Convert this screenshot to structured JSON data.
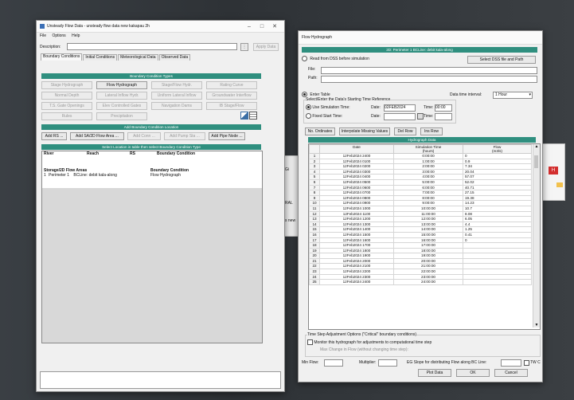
{
  "unsteady": {
    "title": "Unsteady Flow Data - unsteady flow data new kakapau 2h",
    "menu": [
      "File",
      "Options",
      "Help"
    ],
    "description_label": "Description:",
    "apply_label": "Apply Data",
    "tabs": [
      "Boundary Conditions",
      "Initial Conditions",
      "Meteorological Data",
      "Observed Data"
    ],
    "bc_types_header": "Boundary Condition Types",
    "bc_buttons": [
      {
        "label": "Stage Hydrograph",
        "enabled": false
      },
      {
        "label": "Flow Hydrograph",
        "enabled": true
      },
      {
        "label": "Stage/Flow Hydr.",
        "enabled": false
      },
      {
        "label": "Rating Curve",
        "enabled": false
      },
      {
        "label": "Normal Depth",
        "enabled": false
      },
      {
        "label": "Lateral Inflow Hydr.",
        "enabled": false
      },
      {
        "label": "Uniform Lateral Inflow",
        "enabled": false
      },
      {
        "label": "Groundwater Interflow",
        "enabled": false
      },
      {
        "label": "T.S. Gate Openings",
        "enabled": false
      },
      {
        "label": "Elev Controlled Gates",
        "enabled": false
      },
      {
        "label": "Navigation Dams",
        "enabled": false
      },
      {
        "label": "IB Stage/Flow",
        "enabled": false
      },
      {
        "label": "Rules",
        "enabled": false
      },
      {
        "label": "Precipitation",
        "enabled": false
      }
    ],
    "add_loc_header": "Add Boundary Condition Location",
    "add_buttons": [
      {
        "label": "Add RS ...",
        "enabled": true
      },
      {
        "label": "Add SA/2D Flow Area ...",
        "enabled": true
      },
      {
        "label": "Add Conn ...",
        "enabled": false
      },
      {
        "label": "Add Pump Sta ...",
        "enabled": false
      },
      {
        "label": "Add Pipe Node ...",
        "enabled": true
      }
    ],
    "select_header": "Select Location in table then select Boundary Condition Type",
    "loc_cols": [
      "River",
      "Reach",
      "RS",
      "Boundary Condition"
    ],
    "storage_header": [
      "Storage/2D Flow Areas",
      "Boundary Condition"
    ],
    "storage_rows": [
      {
        "num": "1",
        "area": "Perimeter 1",
        "line": "BCLine: debit kala-along",
        "bc": "Flow Hydrograph"
      }
    ]
  },
  "flow": {
    "title": "Flow Hydrograph",
    "location_header": "2D: Perimeter 1 BCLine: debit kala-along",
    "read_dss_label": "Read from DSS before simulation",
    "select_dss_label": "Select DSS file and Path",
    "file_label": "File:",
    "path_label": "Path:",
    "enter_table_label": "Enter Table",
    "interval_label": "Data time interval:",
    "interval_value": "1 Hour",
    "start_ref_label": "Select/Enter the Data's Starting Time Reference",
    "use_sim_label": "Use Simulation Time:",
    "date_label": "Date:",
    "sim_date": "02FEB2024",
    "time_label": "Time:",
    "sim_time": "00:00",
    "fixed_label": "Fixed Start Time:",
    "fixed_date_label": "Date:",
    "fixed_time_label": "Time:",
    "table_buttons": [
      "No. Ordinates",
      "Interpolate Missing Values",
      "Del Row",
      "Ins Row"
    ],
    "table_header": "Hydrograph Data",
    "col_date": "Date",
    "col_sim": "Simulation Time",
    "col_sim_unit": "(hours)",
    "col_flow": "Flow",
    "col_flow_unit": "(m3/s)",
    "rows": [
      {
        "n": "1",
        "date": "12Feb2024 2400",
        "sim": "0:00:00",
        "flow": "0"
      },
      {
        "n": "2",
        "date": "12Feb2024 0100",
        "sim": "1:00:00",
        "flow": "0.9"
      },
      {
        "n": "3",
        "date": "12Feb2024 0200",
        "sim": "2:00:00",
        "flow": "7.34"
      },
      {
        "n": "4",
        "date": "12Feb2024 0300",
        "sim": "3:00:00",
        "flow": "20.04"
      },
      {
        "n": "5",
        "date": "12Feb2024 0400",
        "sim": "4:00:00",
        "flow": "57.07"
      },
      {
        "n": "6",
        "date": "12Feb2024 0500",
        "sim": "5:00:00",
        "flow": "52.02"
      },
      {
        "n": "7",
        "date": "12Feb2024 0600",
        "sim": "6:00:00",
        "flow": "40.71"
      },
      {
        "n": "8",
        "date": "12Feb2024 0700",
        "sim": "7:00:00",
        "flow": "27.15"
      },
      {
        "n": "9",
        "date": "12Feb2024 0800",
        "sim": "8:00:00",
        "flow": "19.38"
      },
      {
        "n": "10",
        "date": "12Feb2024 0900",
        "sim": "9:00:00",
        "flow": "14.23"
      },
      {
        "n": "11",
        "date": "12Feb2024 1000",
        "sim": "10:00:00",
        "flow": "10.7"
      },
      {
        "n": "12",
        "date": "12Feb2024 1100",
        "sim": "11:00:00",
        "flow": "8.08"
      },
      {
        "n": "13",
        "date": "12Feb2024 1200",
        "sim": "12:00:00",
        "flow": "6.05"
      },
      {
        "n": "14",
        "date": "12Feb2024 1300",
        "sim": "13:00:00",
        "flow": "4.4"
      },
      {
        "n": "15",
        "date": "12Feb2024 1400",
        "sim": "14:00:00",
        "flow": "1.25"
      },
      {
        "n": "16",
        "date": "12Feb2024 1500",
        "sim": "15:00:00",
        "flow": "0.41"
      },
      {
        "n": "17",
        "date": "12Feb2024 1600",
        "sim": "16:00:00",
        "flow": "0"
      },
      {
        "n": "18",
        "date": "12Feb2024 1700",
        "sim": "17:00:00",
        "flow": ""
      },
      {
        "n": "19",
        "date": "12Feb2024 1800",
        "sim": "18:00:00",
        "flow": ""
      },
      {
        "n": "20",
        "date": "12Feb2024 1900",
        "sim": "19:00:00",
        "flow": ""
      },
      {
        "n": "21",
        "date": "12Feb2024 2000",
        "sim": "20:00:00",
        "flow": ""
      },
      {
        "n": "22",
        "date": "12Feb2024 2100",
        "sim": "21:00:00",
        "flow": ""
      },
      {
        "n": "23",
        "date": "12Feb2024 2200",
        "sim": "22:00:00",
        "flow": ""
      },
      {
        "n": "24",
        "date": "12Feb2024 2300",
        "sim": "23:00:00",
        "flow": ""
      },
      {
        "n": "25",
        "date": "12Feb2024 2400",
        "sim": "24:00:00",
        "flow": ""
      }
    ],
    "ts_header": "Time Step Adjustment Options (\"Critical\" boundary conditions)",
    "monitor_label": "Monitor this hydrograph for adjustments to computational time step",
    "max_change_label": "Max Change in Flow (without changing time step):",
    "min_flow_label": "Min Flow:",
    "multiplier_label": "Multiplier:",
    "eg_slope_label": "EG Slope for distributing Flow along BC Line:",
    "tw_label": "TW C",
    "plot_label": "Plot Data",
    "ok_label": "OK",
    "cancel_label": "Cancel"
  },
  "background": {
    "frag_a": "RAL",
    "frag_b": "s new",
    "frag_c": "Gi"
  }
}
